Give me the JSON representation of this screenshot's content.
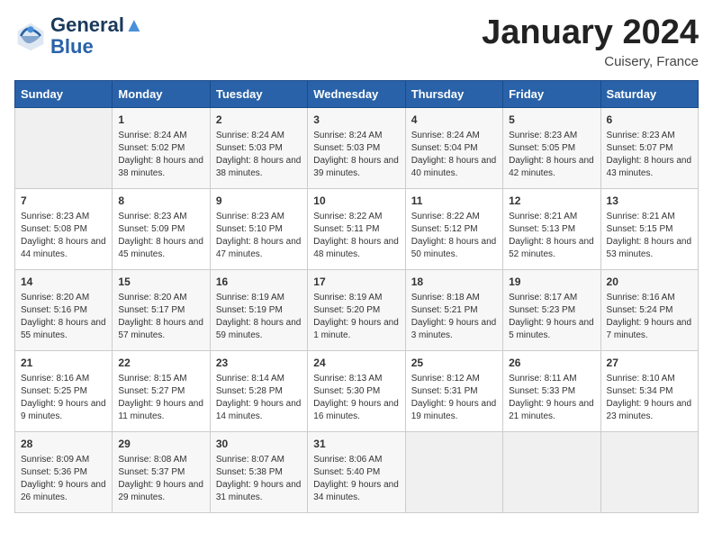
{
  "header": {
    "logo": {
      "line1": "General",
      "line2": "Blue"
    },
    "title": "January 2024",
    "location": "Cuisery, France"
  },
  "days_of_week": [
    "Sunday",
    "Monday",
    "Tuesday",
    "Wednesday",
    "Thursday",
    "Friday",
    "Saturday"
  ],
  "weeks": [
    [
      {
        "day": "",
        "sunrise": "",
        "sunset": "",
        "daylight": ""
      },
      {
        "day": "1",
        "sunrise": "Sunrise: 8:24 AM",
        "sunset": "Sunset: 5:02 PM",
        "daylight": "Daylight: 8 hours and 38 minutes."
      },
      {
        "day": "2",
        "sunrise": "Sunrise: 8:24 AM",
        "sunset": "Sunset: 5:03 PM",
        "daylight": "Daylight: 8 hours and 38 minutes."
      },
      {
        "day": "3",
        "sunrise": "Sunrise: 8:24 AM",
        "sunset": "Sunset: 5:03 PM",
        "daylight": "Daylight: 8 hours and 39 minutes."
      },
      {
        "day": "4",
        "sunrise": "Sunrise: 8:24 AM",
        "sunset": "Sunset: 5:04 PM",
        "daylight": "Daylight: 8 hours and 40 minutes."
      },
      {
        "day": "5",
        "sunrise": "Sunrise: 8:23 AM",
        "sunset": "Sunset: 5:05 PM",
        "daylight": "Daylight: 8 hours and 42 minutes."
      },
      {
        "day": "6",
        "sunrise": "Sunrise: 8:23 AM",
        "sunset": "Sunset: 5:07 PM",
        "daylight": "Daylight: 8 hours and 43 minutes."
      }
    ],
    [
      {
        "day": "7",
        "sunrise": "Sunrise: 8:23 AM",
        "sunset": "Sunset: 5:08 PM",
        "daylight": "Daylight: 8 hours and 44 minutes."
      },
      {
        "day": "8",
        "sunrise": "Sunrise: 8:23 AM",
        "sunset": "Sunset: 5:09 PM",
        "daylight": "Daylight: 8 hours and 45 minutes."
      },
      {
        "day": "9",
        "sunrise": "Sunrise: 8:23 AM",
        "sunset": "Sunset: 5:10 PM",
        "daylight": "Daylight: 8 hours and 47 minutes."
      },
      {
        "day": "10",
        "sunrise": "Sunrise: 8:22 AM",
        "sunset": "Sunset: 5:11 PM",
        "daylight": "Daylight: 8 hours and 48 minutes."
      },
      {
        "day": "11",
        "sunrise": "Sunrise: 8:22 AM",
        "sunset": "Sunset: 5:12 PM",
        "daylight": "Daylight: 8 hours and 50 minutes."
      },
      {
        "day": "12",
        "sunrise": "Sunrise: 8:21 AM",
        "sunset": "Sunset: 5:13 PM",
        "daylight": "Daylight: 8 hours and 52 minutes."
      },
      {
        "day": "13",
        "sunrise": "Sunrise: 8:21 AM",
        "sunset": "Sunset: 5:15 PM",
        "daylight": "Daylight: 8 hours and 53 minutes."
      }
    ],
    [
      {
        "day": "14",
        "sunrise": "Sunrise: 8:20 AM",
        "sunset": "Sunset: 5:16 PM",
        "daylight": "Daylight: 8 hours and 55 minutes."
      },
      {
        "day": "15",
        "sunrise": "Sunrise: 8:20 AM",
        "sunset": "Sunset: 5:17 PM",
        "daylight": "Daylight: 8 hours and 57 minutes."
      },
      {
        "day": "16",
        "sunrise": "Sunrise: 8:19 AM",
        "sunset": "Sunset: 5:19 PM",
        "daylight": "Daylight: 8 hours and 59 minutes."
      },
      {
        "day": "17",
        "sunrise": "Sunrise: 8:19 AM",
        "sunset": "Sunset: 5:20 PM",
        "daylight": "Daylight: 9 hours and 1 minute."
      },
      {
        "day": "18",
        "sunrise": "Sunrise: 8:18 AM",
        "sunset": "Sunset: 5:21 PM",
        "daylight": "Daylight: 9 hours and 3 minutes."
      },
      {
        "day": "19",
        "sunrise": "Sunrise: 8:17 AM",
        "sunset": "Sunset: 5:23 PM",
        "daylight": "Daylight: 9 hours and 5 minutes."
      },
      {
        "day": "20",
        "sunrise": "Sunrise: 8:16 AM",
        "sunset": "Sunset: 5:24 PM",
        "daylight": "Daylight: 9 hours and 7 minutes."
      }
    ],
    [
      {
        "day": "21",
        "sunrise": "Sunrise: 8:16 AM",
        "sunset": "Sunset: 5:25 PM",
        "daylight": "Daylight: 9 hours and 9 minutes."
      },
      {
        "day": "22",
        "sunrise": "Sunrise: 8:15 AM",
        "sunset": "Sunset: 5:27 PM",
        "daylight": "Daylight: 9 hours and 11 minutes."
      },
      {
        "day": "23",
        "sunrise": "Sunrise: 8:14 AM",
        "sunset": "Sunset: 5:28 PM",
        "daylight": "Daylight: 9 hours and 14 minutes."
      },
      {
        "day": "24",
        "sunrise": "Sunrise: 8:13 AM",
        "sunset": "Sunset: 5:30 PM",
        "daylight": "Daylight: 9 hours and 16 minutes."
      },
      {
        "day": "25",
        "sunrise": "Sunrise: 8:12 AM",
        "sunset": "Sunset: 5:31 PM",
        "daylight": "Daylight: 9 hours and 19 minutes."
      },
      {
        "day": "26",
        "sunrise": "Sunrise: 8:11 AM",
        "sunset": "Sunset: 5:33 PM",
        "daylight": "Daylight: 9 hours and 21 minutes."
      },
      {
        "day": "27",
        "sunrise": "Sunrise: 8:10 AM",
        "sunset": "Sunset: 5:34 PM",
        "daylight": "Daylight: 9 hours and 23 minutes."
      }
    ],
    [
      {
        "day": "28",
        "sunrise": "Sunrise: 8:09 AM",
        "sunset": "Sunset: 5:36 PM",
        "daylight": "Daylight: 9 hours and 26 minutes."
      },
      {
        "day": "29",
        "sunrise": "Sunrise: 8:08 AM",
        "sunset": "Sunset: 5:37 PM",
        "daylight": "Daylight: 9 hours and 29 minutes."
      },
      {
        "day": "30",
        "sunrise": "Sunrise: 8:07 AM",
        "sunset": "Sunset: 5:38 PM",
        "daylight": "Daylight: 9 hours and 31 minutes."
      },
      {
        "day": "31",
        "sunrise": "Sunrise: 8:06 AM",
        "sunset": "Sunset: 5:40 PM",
        "daylight": "Daylight: 9 hours and 34 minutes."
      },
      {
        "day": "",
        "sunrise": "",
        "sunset": "",
        "daylight": ""
      },
      {
        "day": "",
        "sunrise": "",
        "sunset": "",
        "daylight": ""
      },
      {
        "day": "",
        "sunrise": "",
        "sunset": "",
        "daylight": ""
      }
    ]
  ]
}
